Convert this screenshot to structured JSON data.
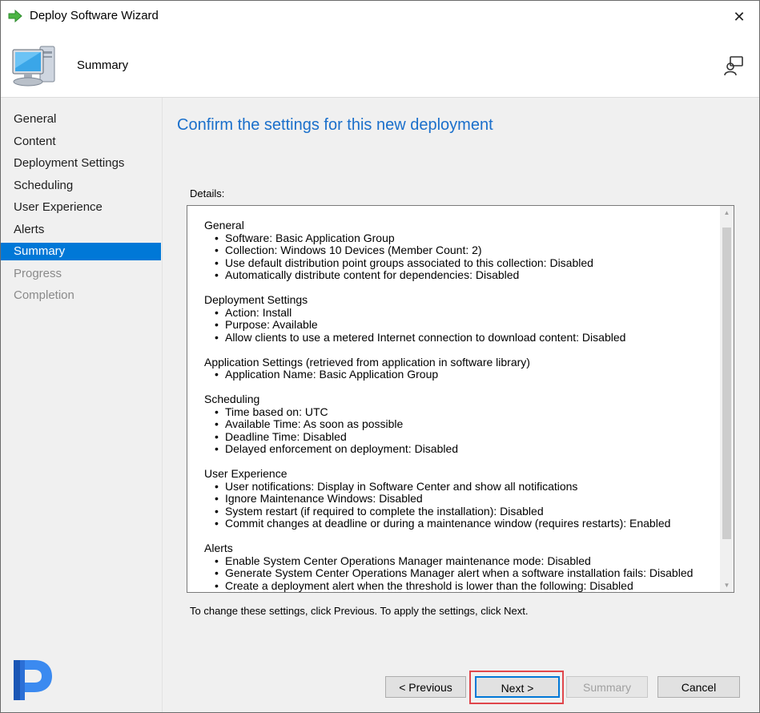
{
  "window": {
    "title": "Deploy Software Wizard"
  },
  "header": {
    "subtitle": "Summary"
  },
  "sidebar": {
    "items": [
      {
        "label": "General",
        "state": "normal"
      },
      {
        "label": "Content",
        "state": "normal"
      },
      {
        "label": "Deployment Settings",
        "state": "normal"
      },
      {
        "label": "Scheduling",
        "state": "normal"
      },
      {
        "label": "User Experience",
        "state": "normal"
      },
      {
        "label": "Alerts",
        "state": "normal"
      },
      {
        "label": "Summary",
        "state": "selected"
      },
      {
        "label": "Progress",
        "state": "disabled"
      },
      {
        "label": "Completion",
        "state": "disabled"
      }
    ]
  },
  "main": {
    "heading": "Confirm the settings for this new deployment",
    "details_label": "Details:",
    "hint": "To change these settings, click Previous. To apply the settings, click Next.",
    "sections": [
      {
        "title": "General",
        "items": [
          "Software: Basic Application Group",
          "Collection: Windows 10 Devices (Member Count: 2)",
          "Use default distribution point groups associated to this collection: Disabled",
          "Automatically distribute content for dependencies: Disabled"
        ]
      },
      {
        "title": "Deployment Settings",
        "items": [
          "Action: Install",
          "Purpose: Available",
          "Allow clients to use a metered Internet connection to download content: Disabled"
        ]
      },
      {
        "title": "Application Settings (retrieved from application in software library)",
        "items": [
          "Application Name: Basic Application Group"
        ]
      },
      {
        "title": "Scheduling",
        "items": [
          "Time based on: UTC",
          "Available Time: As soon as possible",
          "Deadline Time: Disabled",
          "Delayed enforcement on deployment: Disabled"
        ]
      },
      {
        "title": "User Experience",
        "items": [
          "User notifications: Display in Software Center and show all notifications",
          "Ignore Maintenance Windows: Disabled",
          "System restart  (if required to complete the installation): Disabled",
          "Commit changes at deadline or during a maintenance window (requires restarts): Enabled"
        ]
      },
      {
        "title": "Alerts",
        "items": [
          "Enable System Center Operations Manager maintenance mode: Disabled",
          "Generate System Center Operations Manager alert when a software installation fails: Disabled",
          "Create a deployment alert when the threshold is lower than the following: Disabled"
        ]
      }
    ]
  },
  "buttons": {
    "previous": "< Previous",
    "next": "Next >",
    "summary": "Summary",
    "cancel": "Cancel"
  },
  "colors": {
    "accent": "#0078d7",
    "heading": "#1a6fcb",
    "highlight": "#e0474c"
  },
  "icons": [
    "arrow-right-icon",
    "close-icon",
    "computer-icon",
    "help-icon",
    "logo-icon"
  ]
}
